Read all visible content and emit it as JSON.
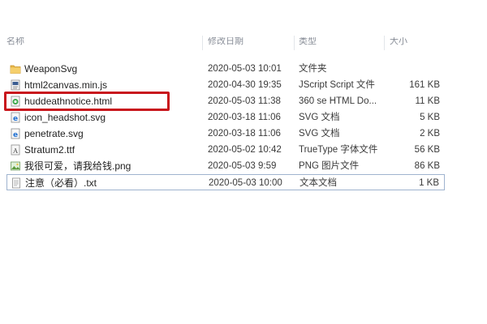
{
  "header": {
    "name": "名称",
    "date": "修改日期",
    "type": "类型",
    "size": "大小"
  },
  "files": [
    {
      "name": "WeaponSvg",
      "date": "2020-05-03 10:01",
      "type": "文件夹",
      "size": "",
      "icon": "folder-icon"
    },
    {
      "name": "html2canvas.min.js",
      "date": "2020-04-30 19:35",
      "type": "JScript Script 文件",
      "size": "161 KB",
      "icon": "script-file-icon"
    },
    {
      "name": "huddeathnotice.html",
      "date": "2020-05-03 11:38",
      "type": "360 se HTML Do...",
      "size": "11 KB",
      "icon": "html-file-icon"
    },
    {
      "name": "icon_headshot.svg",
      "date": "2020-03-18 11:06",
      "type": "SVG 文档",
      "size": "5 KB",
      "icon": "svg-file-icon"
    },
    {
      "name": "penetrate.svg",
      "date": "2020-03-18 11:06",
      "type": "SVG 文档",
      "size": "2 KB",
      "icon": "svg-file-icon"
    },
    {
      "name": "Stratum2.ttf",
      "date": "2020-05-02 10:42",
      "type": "TrueType 字体文件",
      "size": "56 KB",
      "icon": "font-file-icon"
    },
    {
      "name": "我很可爱，请我给钱.png",
      "date": "2020-05-03 9:59",
      "type": "PNG 图片文件",
      "size": "86 KB",
      "icon": "image-file-icon"
    },
    {
      "name": "注意（必看）.txt",
      "date": "2020-05-03 10:00",
      "type": "文本文档",
      "size": "1 KB",
      "icon": "text-file-icon"
    }
  ],
  "highlight_color": "#c8161d"
}
